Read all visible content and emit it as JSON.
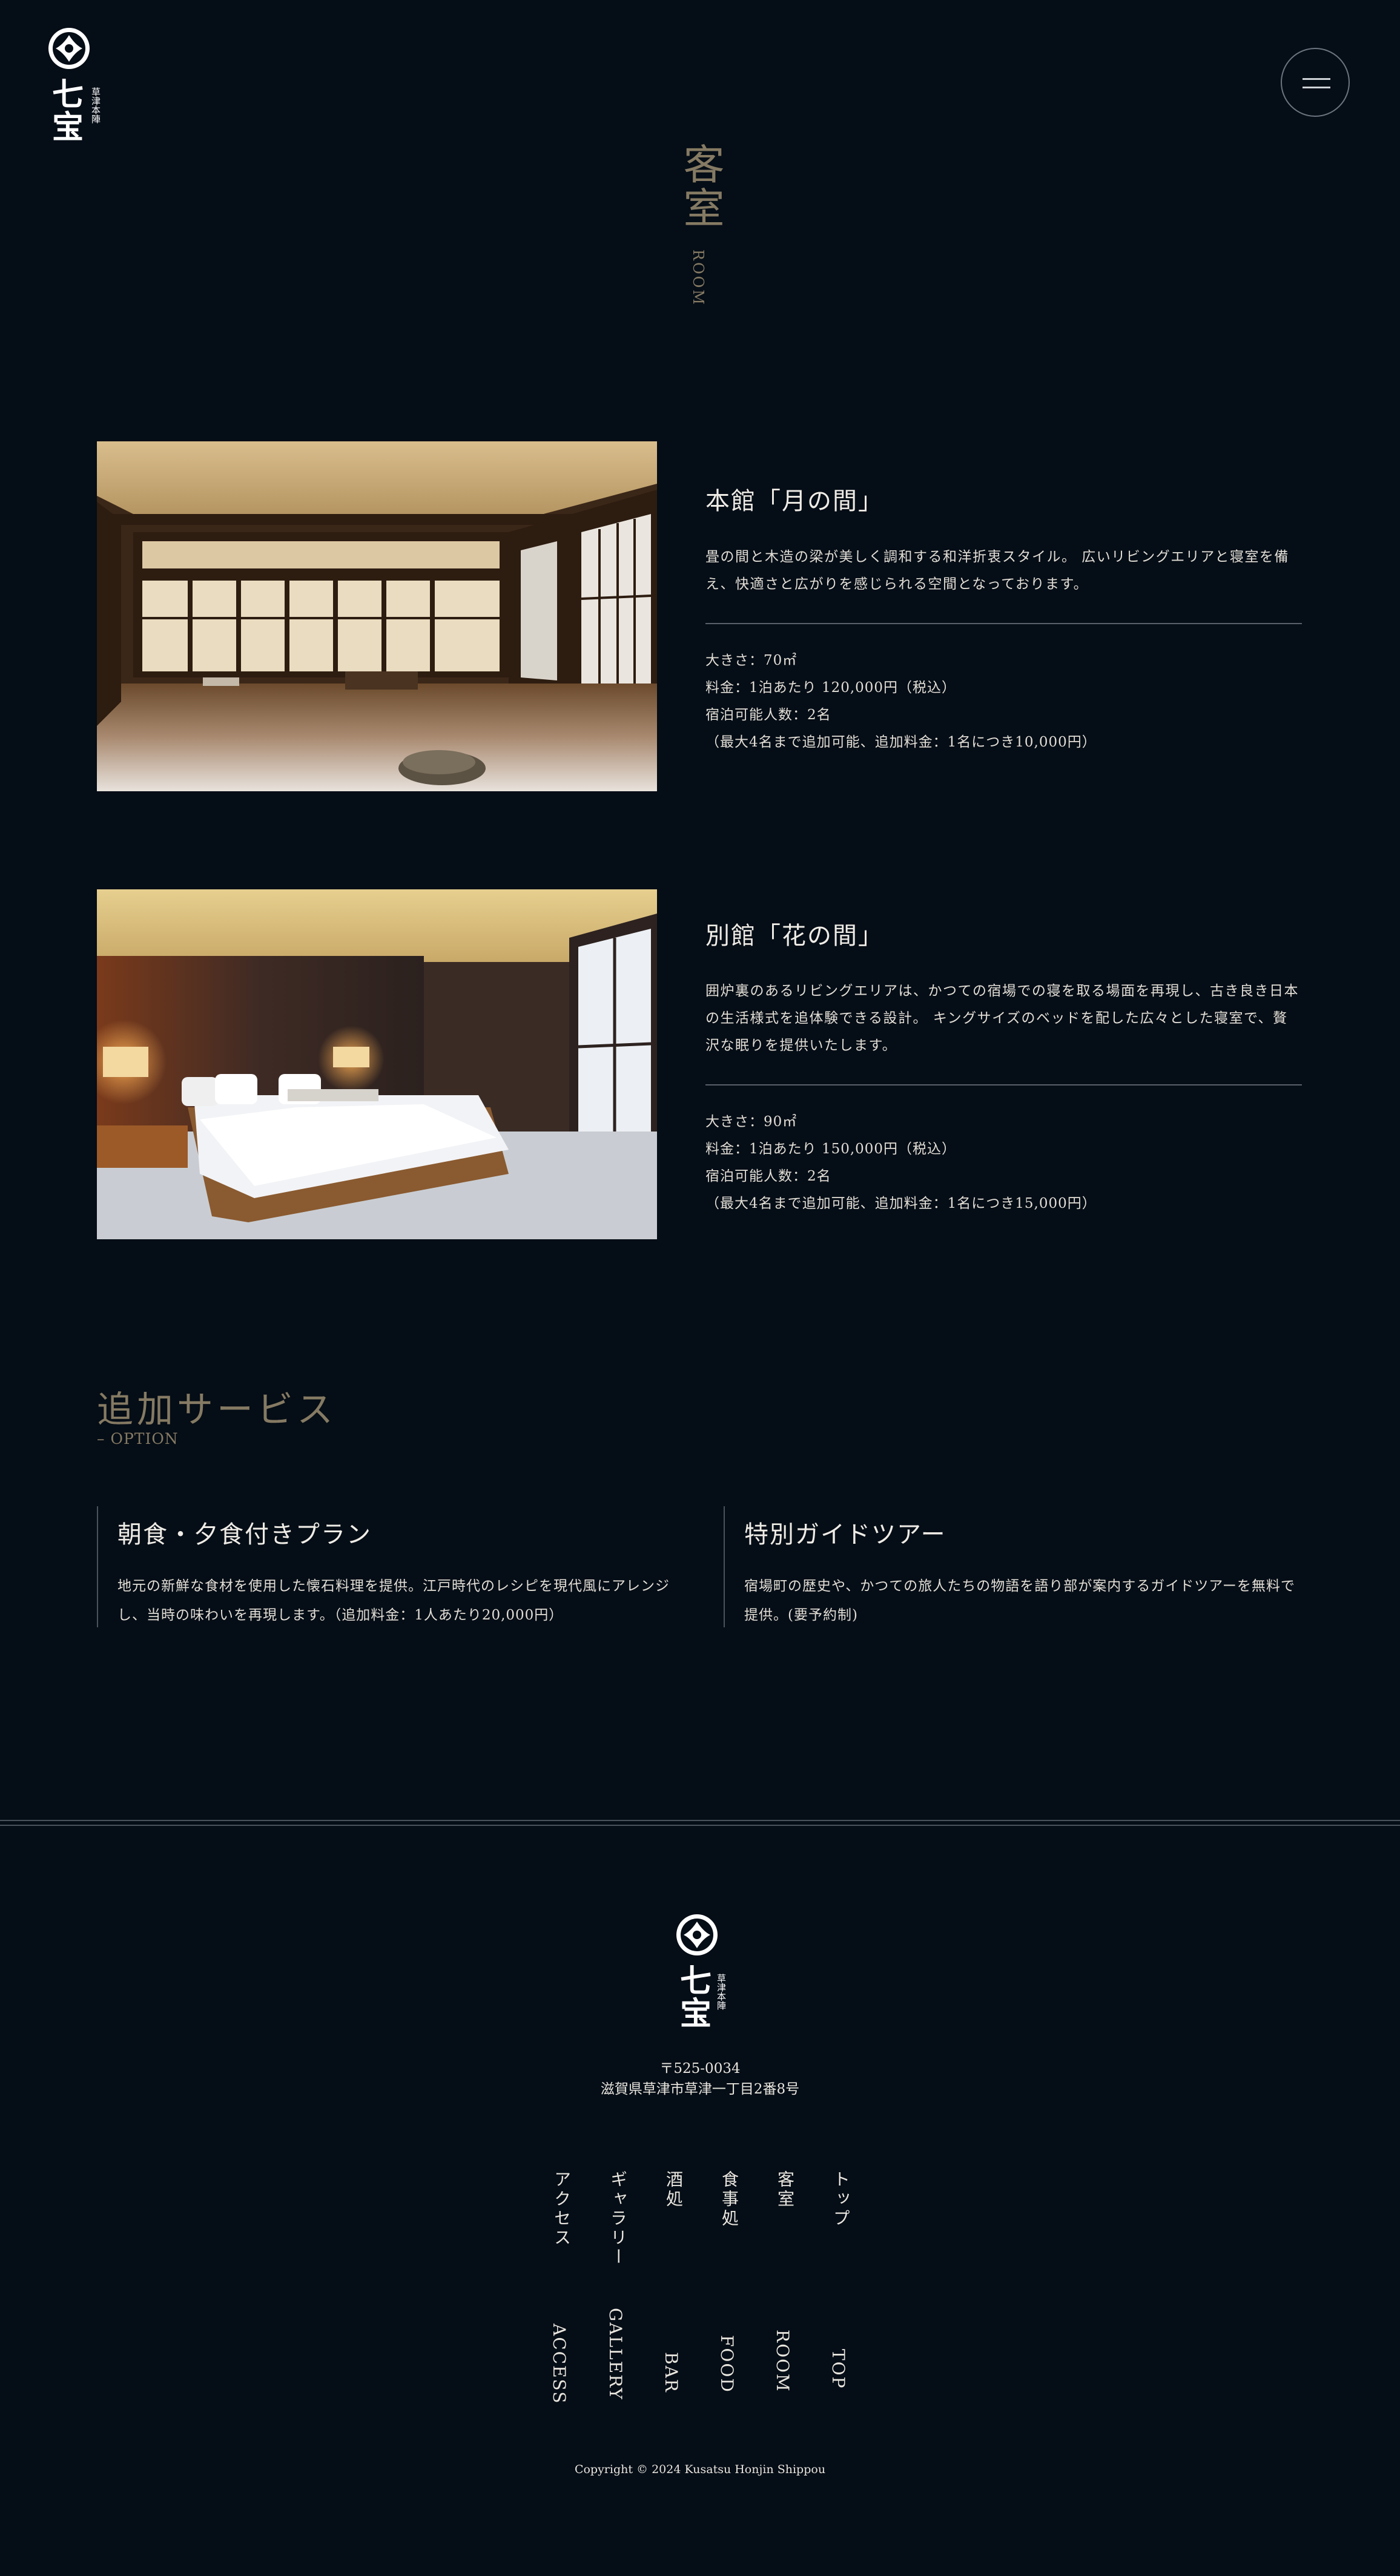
{
  "header": {
    "logo_name": "七宝",
    "logo_sub": "草津本陣",
    "menu_label": "menu"
  },
  "page": {
    "title": "客室",
    "title_en": "ROOM"
  },
  "rooms": [
    {
      "name": "本館「月の間」",
      "description": "畳の間と木造の梁が美しく調和する和洋折衷スタイル。 広いリビングエリアと寝室を備え、快適さと広がりを感じられる空間となっております。",
      "specs": [
        "大きさ：70㎡",
        "料金：1泊あたり 120,000円（税込）",
        "宿泊可能人数：2名",
        "（最大4名まで追加可能、追加料金：1名につき10,000円）"
      ]
    },
    {
      "name": "別館「花の間」",
      "description": "囲炉裏のあるリビングエリアは、かつての宿場での寝を取る場面を再現し、古き良き日本の生活様式を追体験できる設計。 キングサイズのベッドを配した広々とした寝室で、贅沢な眠りを提供いたします。",
      "specs": [
        "大きさ：90㎡",
        "料金：1泊あたり 150,000円（税込）",
        "宿泊可能人数：2名",
        "（最大4名まで追加可能、追加料金：1名につき15,000円）"
      ]
    }
  ],
  "options": {
    "title": "追加サービス",
    "subtitle": "– OPTION",
    "items": [
      {
        "name": "朝食・夕食付きプラン",
        "description": "地元の新鮮な食材を使用した懐石料理を提供。江戸時代のレシピを現代風にアレンジし、当時の味わいを再現します。（追加料金：1人あたり20,000円）"
      },
      {
        "name": "特別ガイドツアー",
        "description": "宿場町の歴史や、かつての旅人たちの物語を語り部が案内するガイドツアーを無料で提供。(要予約制)"
      }
    ]
  },
  "footer": {
    "postal": "〒525-0034",
    "address": "滋賀県草津市草津一丁目2番8号",
    "nav": [
      {
        "ja": "トップ",
        "en": "TOP"
      },
      {
        "ja": "客室",
        "en": "ROOM"
      },
      {
        "ja": "食事処",
        "en": "FOOD"
      },
      {
        "ja": "酒処",
        "en": "BAR"
      },
      {
        "ja": "ギャラリー",
        "en": "GALLERY"
      },
      {
        "ja": "アクセス",
        "en": "ACCESS"
      }
    ],
    "copyright": "Copyright © 2024 Kusatsu Honjin Shippou"
  },
  "colors": {
    "background": "#050d16",
    "accent_gold": "#857a63",
    "text": "#e9e6df"
  }
}
